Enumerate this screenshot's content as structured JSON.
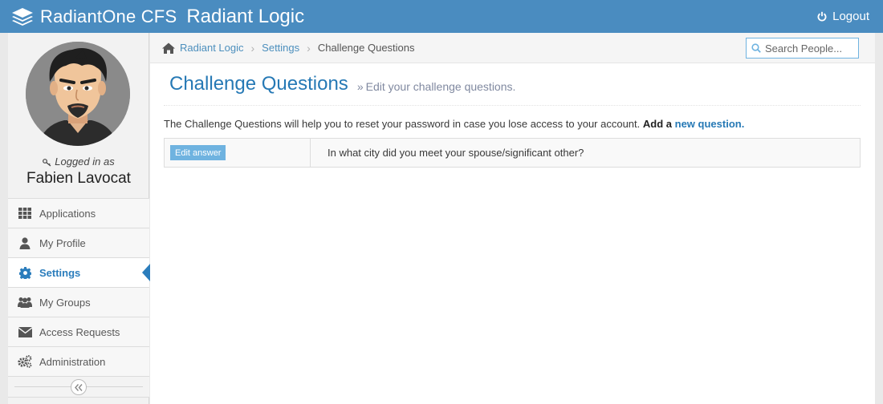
{
  "header": {
    "brand": "RadiantOne CFS",
    "org": "Radiant Logic",
    "logout_label": "Logout"
  },
  "user": {
    "logged_in_label": "Logged in as",
    "name": "Fabien Lavocat"
  },
  "sidebar": {
    "items": [
      {
        "label": "Applications",
        "icon": "grid-icon",
        "active": false
      },
      {
        "label": "My Profile",
        "icon": "user-icon",
        "active": false
      },
      {
        "label": "Settings",
        "icon": "gear-icon",
        "active": true
      },
      {
        "label": "My Groups",
        "icon": "users-icon",
        "active": false
      },
      {
        "label": "Access Requests",
        "icon": "envelope-icon",
        "active": false
      },
      {
        "label": "Administration",
        "icon": "cogs-icon",
        "active": false
      }
    ],
    "collapse_icon": "double-chevron-left-icon"
  },
  "breadcrumb": {
    "items": [
      "Radiant Logic",
      "Settings",
      "Challenge Questions"
    ]
  },
  "search": {
    "placeholder": "Search People..."
  },
  "page": {
    "title": "Challenge Questions",
    "subtitle_prefix": "»",
    "subtitle": "Edit your challenge questions.",
    "intro_text": "The Challenge Questions will help you to reset your password in case you lose access to your account.",
    "add_text": "Add a",
    "add_link": "new question."
  },
  "questions": [
    {
      "button_label": "Edit answer",
      "question": "In what city did you meet your spouse/significant other?"
    }
  ],
  "colors": {
    "navbar": "#4a8cc0",
    "accent": "#2679b5",
    "button": "#6fb3e0"
  }
}
